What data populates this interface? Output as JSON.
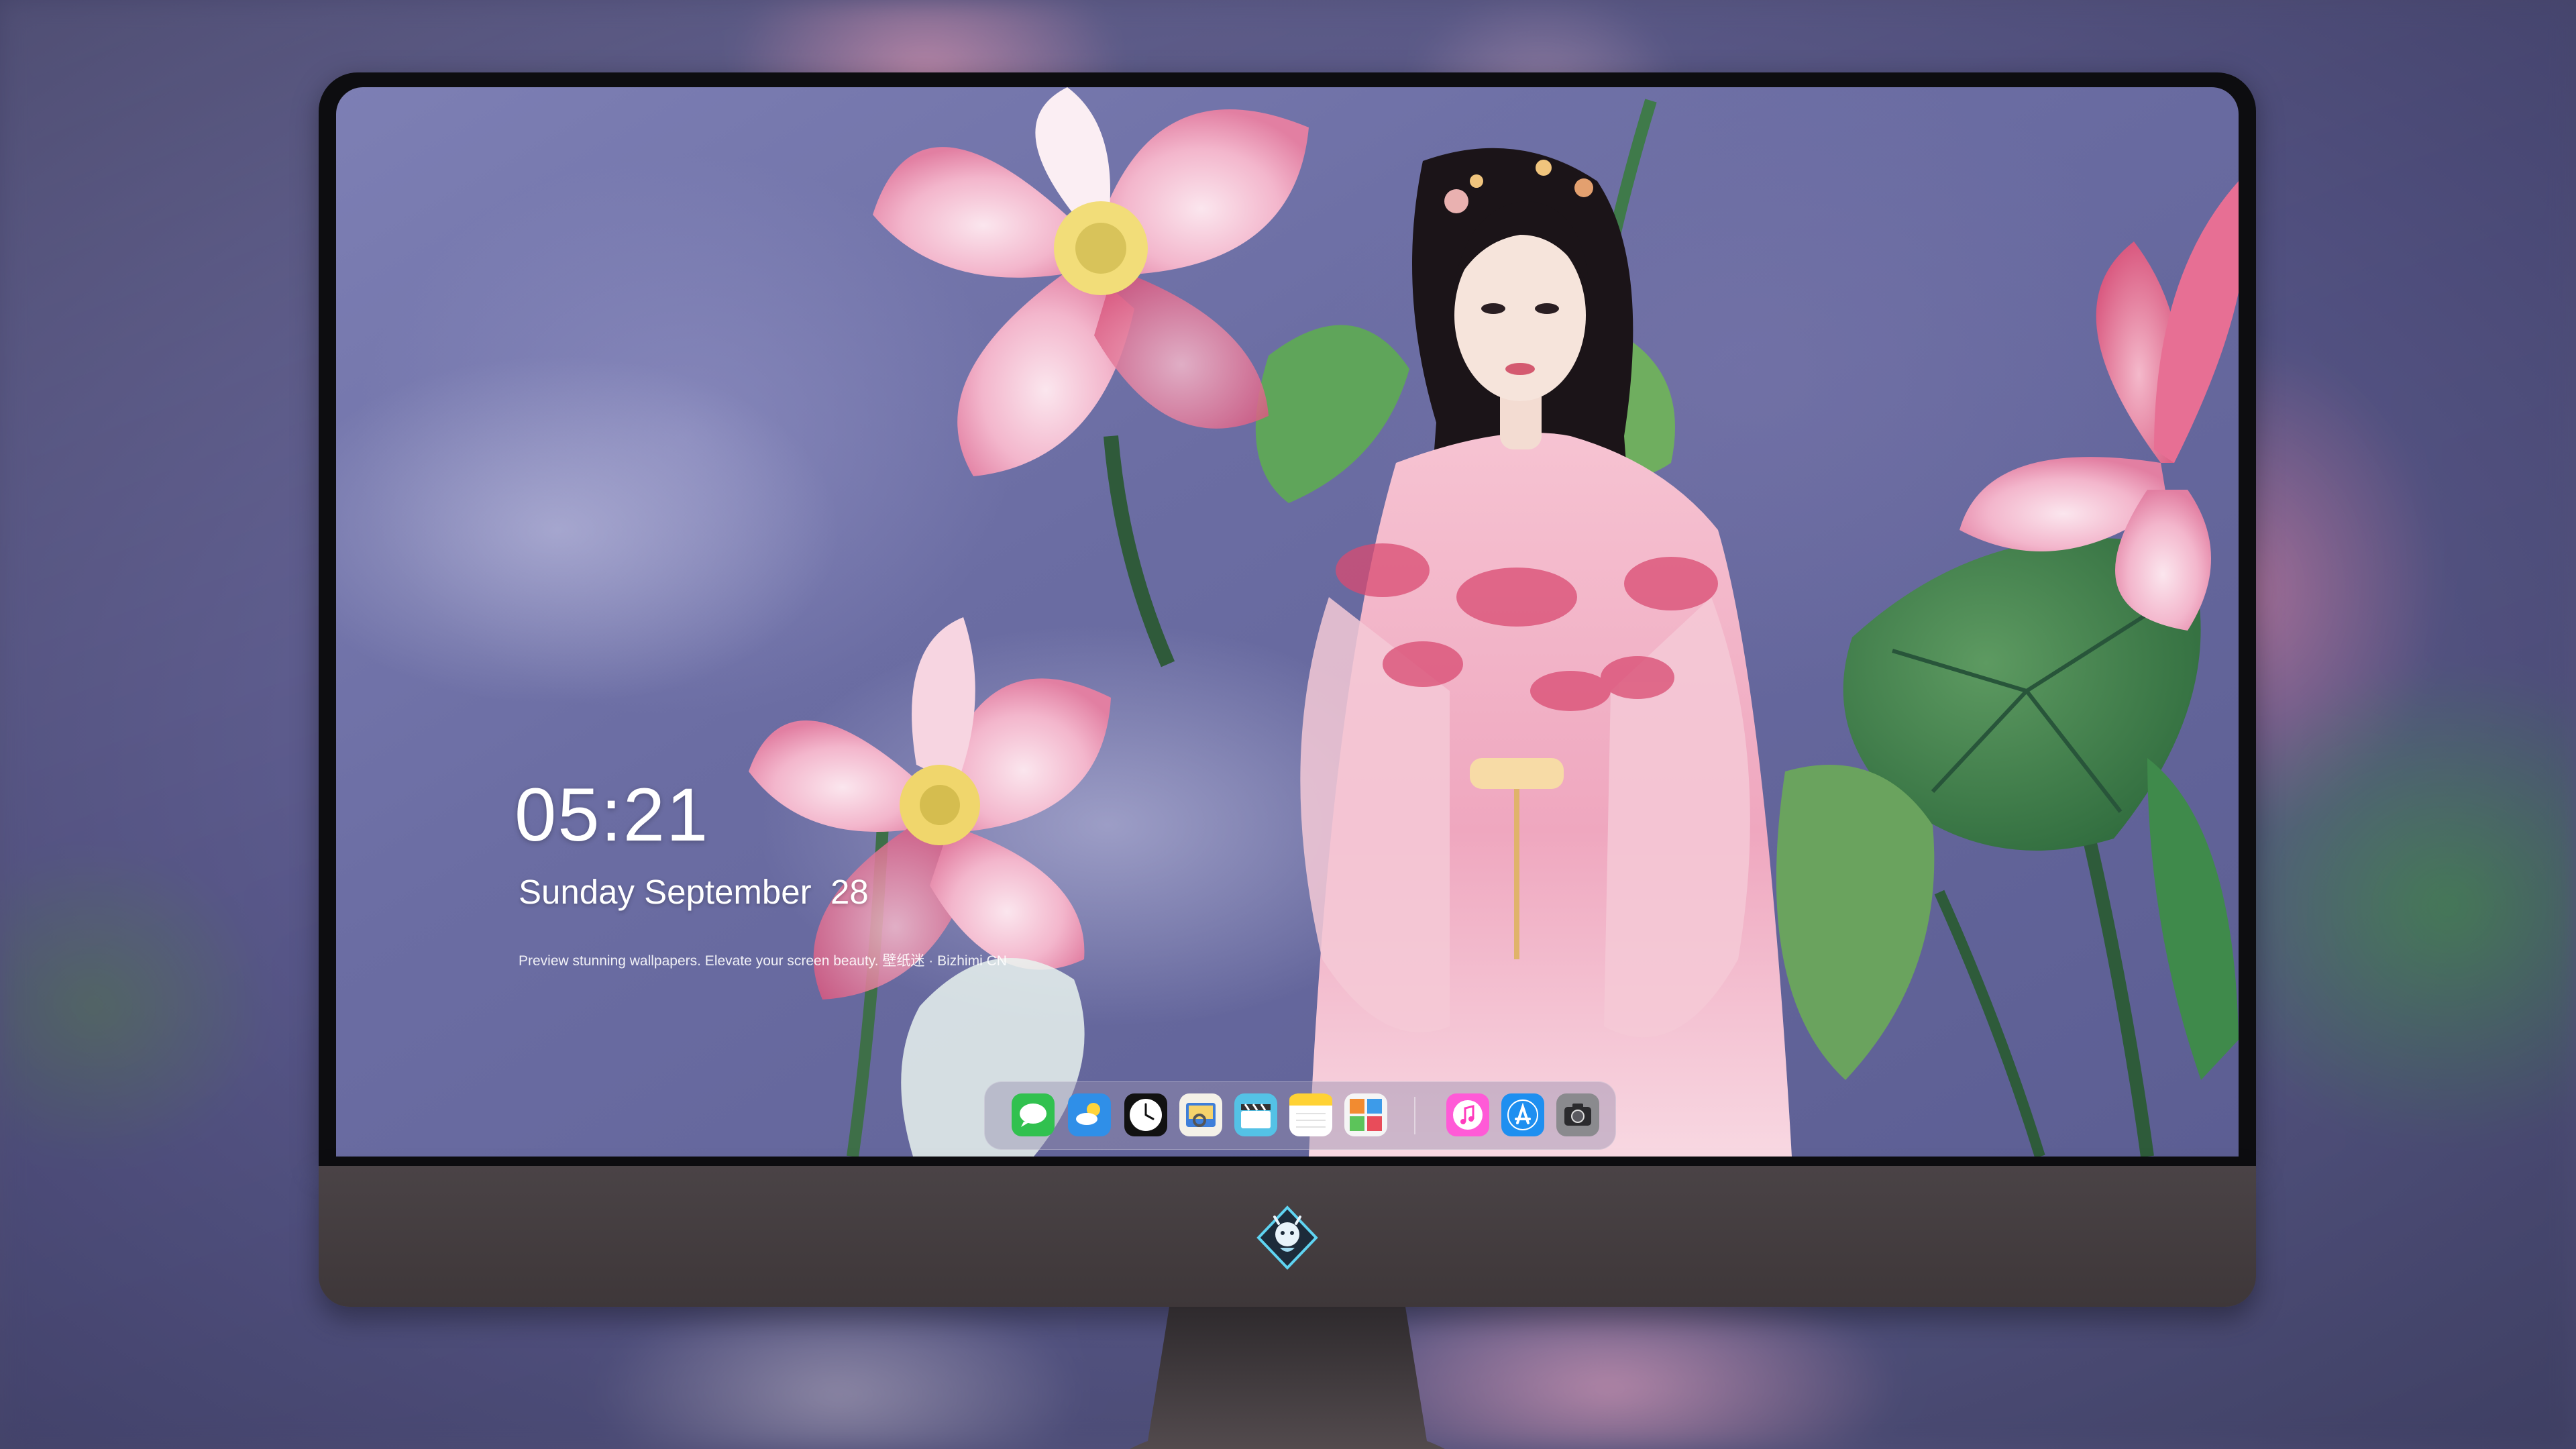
{
  "lock_screen": {
    "time": "05:21",
    "date": "Sunday September  28",
    "tagline": "Preview stunning wallpapers. Elevate your screen beauty. 壁纸迷 · Bizhimi CN"
  },
  "dock": {
    "apps": [
      {
        "icon": "messages-icon"
      },
      {
        "icon": "weather-icon"
      },
      {
        "icon": "clock-icon"
      },
      {
        "icon": "preview-icon"
      },
      {
        "icon": "clapperboard-icon"
      },
      {
        "icon": "notes-icon"
      },
      {
        "icon": "photo-booth-icon"
      },
      {
        "icon": "music-icon"
      },
      {
        "icon": "app-store-icon"
      },
      {
        "icon": "camera-icon"
      }
    ]
  },
  "monitor": {
    "chin_logo": "dragon-mascot-icon"
  },
  "colors": {
    "screen_bezel": "#0d0d10",
    "chin": "#443d40",
    "background": "#5b5a86"
  }
}
